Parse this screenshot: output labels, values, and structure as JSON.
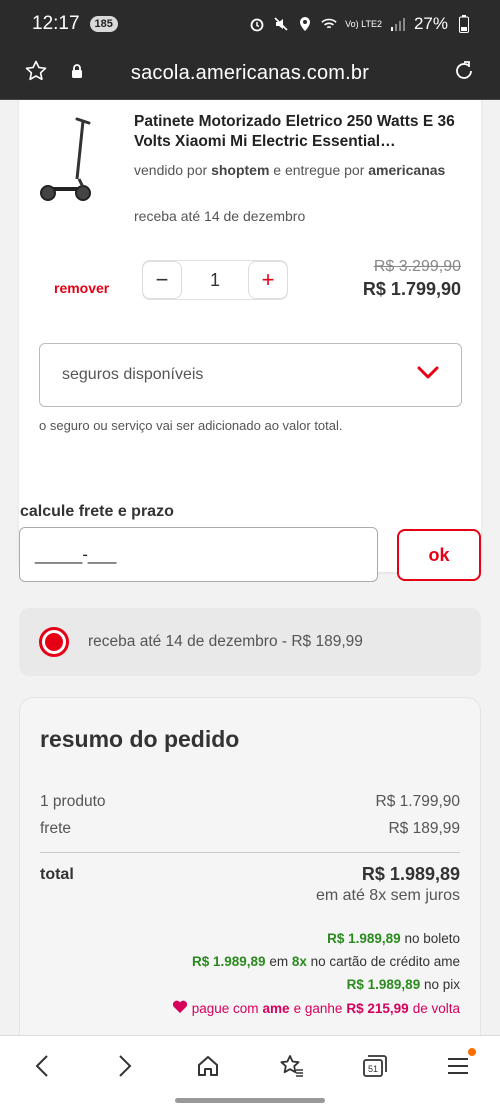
{
  "status_bar": {
    "time": "12:17",
    "notification_count": "185",
    "network": "Vo) LTE2",
    "battery": "27%"
  },
  "browser": {
    "url": "sacola.americanas.com.br"
  },
  "product": {
    "title": "Patinete Motorizado Eletrico 250 Watts E 36 Volts Xiaomi Mi Electric Essential…",
    "seller_prefix": "vendido por",
    "seller": "shoptem",
    "delivered_prefix": "e entregue por",
    "delivered_by": "americanas",
    "delivery": "receba até 14 de dezembro",
    "remove_label": "remover",
    "quantity": "1",
    "minus_label": "−",
    "plus_label": "+",
    "old_price": "R$ 3.299,90",
    "price": "R$ 1.799,90"
  },
  "insurance": {
    "select_label": "seguros disponíveis",
    "note": "o seguro ou serviço vai ser adicionado ao valor total."
  },
  "freight": {
    "title": "calcule frete e prazo",
    "input_value": "_____-___",
    "ok_label": "ok",
    "option_label": "receba até 14 de dezembro - R$ 189,99"
  },
  "summary": {
    "title": "resumo do pedido",
    "rows": [
      {
        "label": "1 produto",
        "value": "R$ 1.799,90"
      },
      {
        "label": "frete",
        "value": "R$ 189,99"
      }
    ],
    "total_label": "total",
    "total_value": "R$ 1.989,89",
    "installments": "em até 8x sem juros",
    "boleto_value": "R$ 1.989,89",
    "boleto_text": "no boleto",
    "card_value": "R$ 1.989,89",
    "card_mid": "em",
    "card_installments": "8x",
    "card_text": "no cartão de crédito ame",
    "pix_value": "R$ 1.989,89",
    "pix_text": "no pix",
    "ame_prefix": "pague com",
    "ame_brand": "ame",
    "ame_mid": "e ganhe",
    "ame_cashback": "R$ 215,99",
    "ame_suffix": "de volta"
  },
  "bottom_nav": {
    "tabs_count": "51"
  },
  "colors": {
    "accent": "#e60014",
    "green": "#2b8a1e",
    "ame_pink": "#d6005c"
  }
}
